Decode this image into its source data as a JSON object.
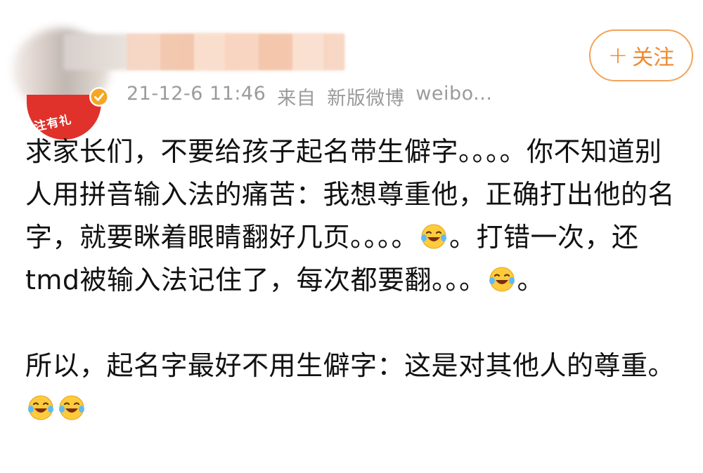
{
  "post": {
    "meta": {
      "timestamp": "21-12-6 11:46",
      "source_prefix": "来自",
      "source_app": "新版微博",
      "source_more": "weibo..."
    },
    "avatar_badge": "注有礼",
    "follow_label": "关注",
    "paragraph1": {
      "t1": "求家长们，不要给孩子起名带生僻字。。。。你不知道别人用拼音输入法的痛苦：我想尊重他，正确打出他的名字，就要眯着眼睛翻好几页。。。。",
      "t2": "。打错一次，还tmd被输入法记住了，每次都要翻。。。",
      "t3": "。"
    },
    "paragraph2": {
      "t1": "所以，起名字最好不用生僻字：这是对其他人的尊重。"
    },
    "emoji_name": "laugh-cry-emoji",
    "colors": {
      "accent": "#f0892b",
      "badge_red": "#e0312b",
      "verified": "#f5a623",
      "meta_text": "#9b9b9b"
    }
  }
}
